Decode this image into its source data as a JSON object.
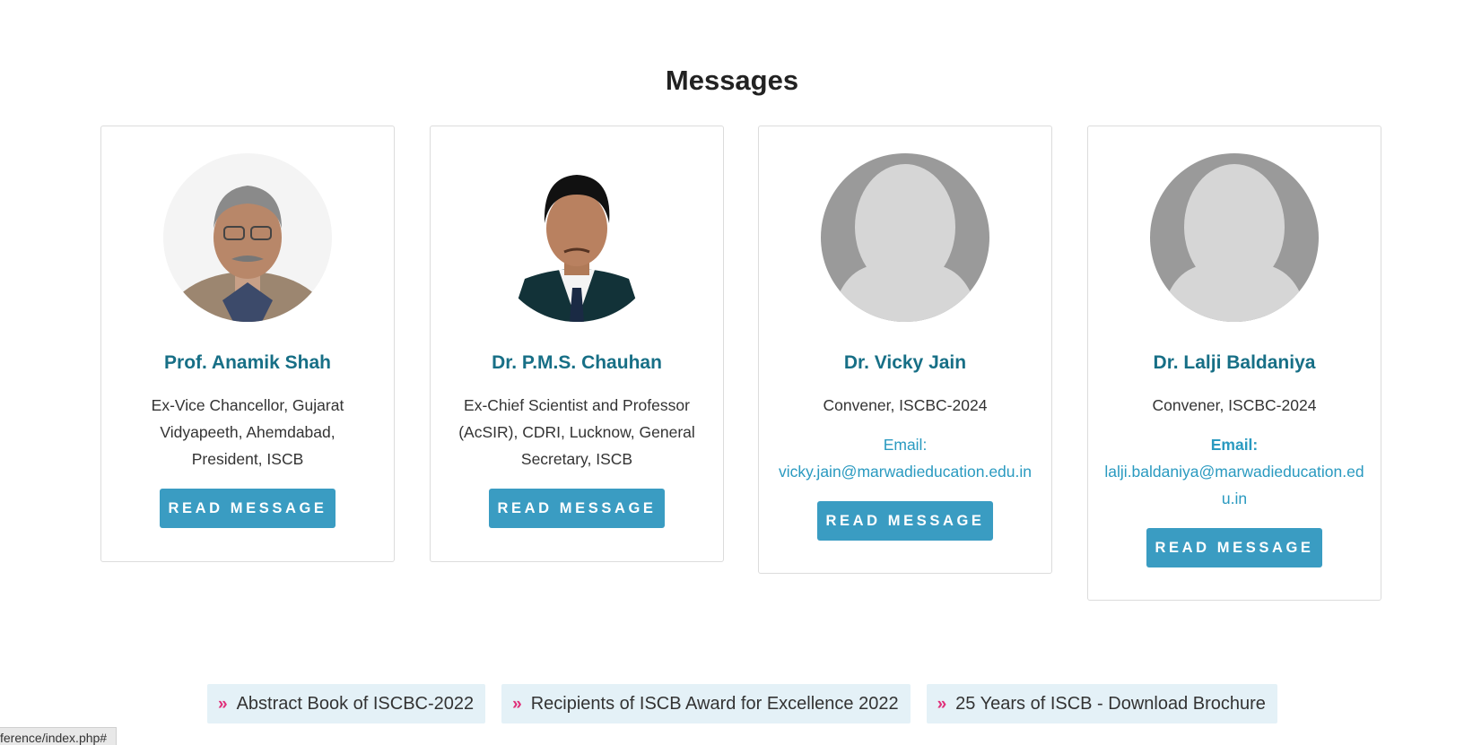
{
  "section": {
    "title": "Messages"
  },
  "cards": [
    {
      "name": "Prof. Anamik Shah",
      "role": "Ex-Vice Chancellor, Gujarat Vidyapeeth, Ahemdabad, President, ISCB",
      "button": "READ MESSAGE"
    },
    {
      "name": "Dr. P.M.S. Chauhan",
      "role": "Ex-Chief Scientist and Professor (AcSIR), CDRI, Lucknow, General Secretary, ISCB",
      "button": "READ MESSAGE"
    },
    {
      "name": "Dr. Vicky Jain",
      "role": "Convener, ISCBC-2024",
      "email_label": "Email:",
      "email": "vicky.jain@marwadieducation.edu.in",
      "button": "READ MESSAGE"
    },
    {
      "name": "Dr. Lalji Baldaniya",
      "role": "Convener, ISCBC-2024",
      "email_label": "Email:",
      "email": "lalji.baldaniya@marwadieducation.edu.in",
      "button": "READ MESSAGE"
    }
  ],
  "links": [
    {
      "icon": "double-chevron-right-icon",
      "label": "Abstract Book of ISCBC-2022"
    },
    {
      "icon": "double-chevron-right-icon",
      "label": "Recipients of ISCB Award for Excellence 2022"
    },
    {
      "icon": "double-chevron-right-icon",
      "label": "25 Years of ISCB - Download Brochure"
    }
  ],
  "status_bar": {
    "url": "ference/index.php#"
  },
  "colors": {
    "name": "#176f86",
    "button": "#3a9cc2",
    "email": "#2a9ac0",
    "chip_bg": "#e4f1f7",
    "chevron": "#e0307a"
  }
}
